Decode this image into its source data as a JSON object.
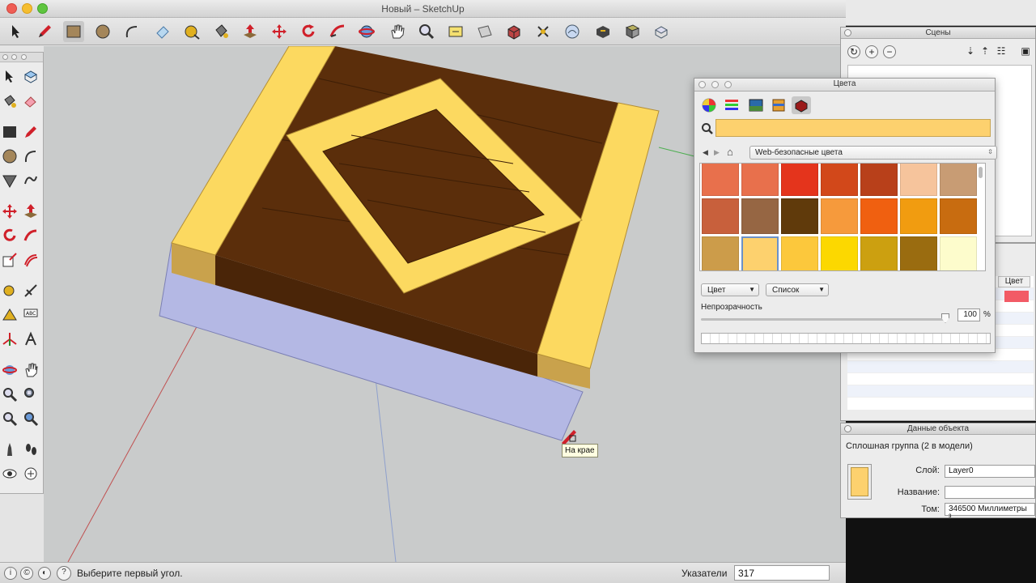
{
  "window": {
    "title": "Новый – SketchUp"
  },
  "toolbar": {
    "icons": [
      "select-tool",
      "pencil-tool",
      "rectangle-tool",
      "circle-tool",
      "arc-tool",
      "eraser-tool",
      "tape-measure-tool",
      "paint-bucket-tool",
      "push-pull-tool",
      "move-tool",
      "rotate-tool",
      "follow-me-tool",
      "orbit-tool",
      "pan-tool",
      "zoom-tool",
      "zoom-window-tool",
      "section-plane-tool",
      "3d-warehouse",
      "components",
      "sandbox",
      "extension-warehouse",
      "styles",
      "export"
    ]
  },
  "viewport": {
    "tooltip": "На крае"
  },
  "statusbar": {
    "message": "Выберите первый угол.",
    "measure_label": "Указатели",
    "measure_value": "317"
  },
  "scenes": {
    "title": "Сцены"
  },
  "layers": {
    "color_header": "Цвет",
    "layer_color": "#f25b66"
  },
  "entity": {
    "title": "Данные объекта",
    "name": "Сплошная группа (2 в модели)",
    "layer_label": "Слой:",
    "layer_value": "Layer0",
    "name_label": "Название:",
    "name_value": "",
    "volume_label": "Том:",
    "volume_value": "346500 Миллиметры ³",
    "material_color": "#fdd16e"
  },
  "colors": {
    "title": "Цвета",
    "current_color": "#fdd16e",
    "palette": "Web-безопасные цвета",
    "swatch_rows": [
      [
        "#e8704c",
        "#e8704c",
        "#e4341c",
        "#d2481a",
        "#b8401a",
        "#f6c49c",
        "#c89c74"
      ],
      [
        "#c8603c",
        "#966643",
        "#603a0b",
        "#f69a3c",
        "#f06010",
        "#f19c10",
        "#c86c10"
      ],
      [
        "#cc9c4a",
        "#fdd16e",
        "#fcc83c",
        "#fcd800",
        "#cca010",
        "#9a6c10",
        "#fdfccc"
      ],
      [
        "#cccca2",
        "#9a9a6c",
        "#6a6a44",
        "#3a3a0a",
        "#fcfc9c",
        "#cccc6c",
        "#cccc3c"
      ]
    ],
    "selected_swatch": "2-1",
    "mode_dropdown": "Цвет",
    "view_dropdown": "Список",
    "opacity_label": "Непрозрачность",
    "opacity_value": "100",
    "opacity_unit": "%"
  }
}
